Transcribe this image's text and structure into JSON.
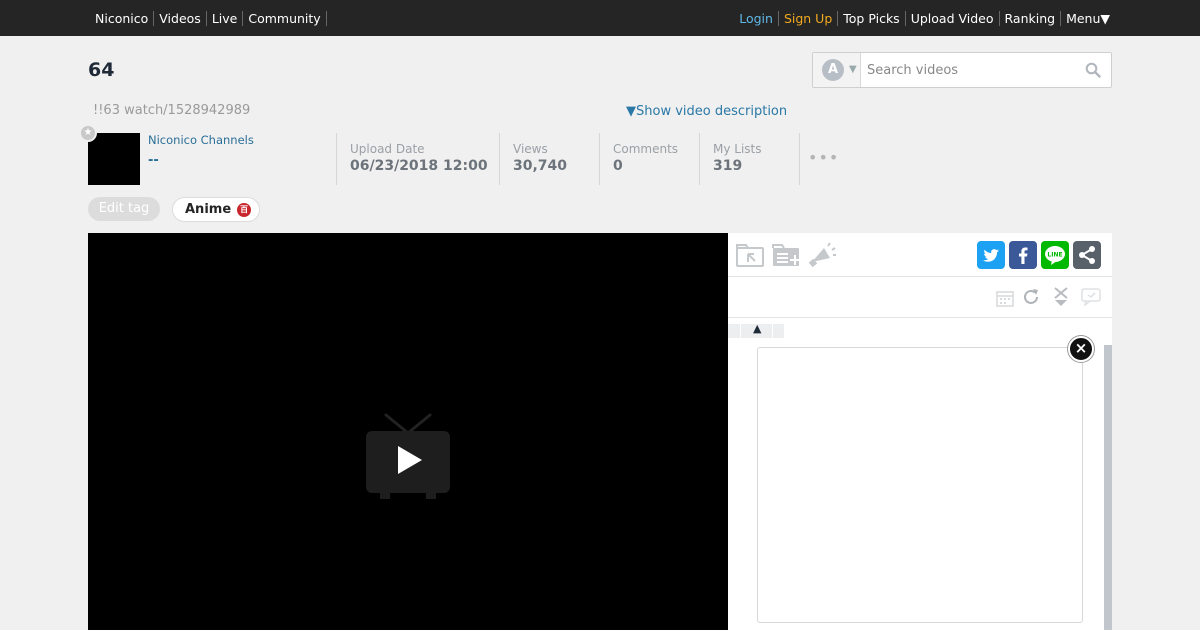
{
  "topbar": {
    "left_links": [
      "Niconico",
      "Videos",
      "Live",
      "Community"
    ],
    "login": "Login",
    "signup": "Sign Up",
    "right_links": [
      "Top Picks",
      "Upload Video",
      "Ranking",
      "Menu▼"
    ]
  },
  "video": {
    "title": "64",
    "subline": "!!63 watch/1528942989",
    "show_description": "▼Show video description"
  },
  "search": {
    "mode_letter": "A",
    "placeholder": "Search videos"
  },
  "owner": {
    "name": "Niconico Channels",
    "sub": "--"
  },
  "stats": {
    "upload_label": "Upload Date",
    "upload_value": "06/23/2018 12:00",
    "views_label": "Views",
    "views_value": "30,740",
    "comments_label": "Comments",
    "comments_value": "0",
    "mylists_label": "My Lists",
    "mylists_value": "319",
    "more": "•••"
  },
  "tags": {
    "edit_label": "Edit tag",
    "items": [
      {
        "label": "Anime",
        "dict_glyph": "百"
      }
    ]
  },
  "panel": {
    "sort_arrow": "▲",
    "close": "×"
  },
  "colors": {
    "topbar_bg": "#252525",
    "login": "#5fb7e6",
    "signup": "#f2a91f",
    "twitter": "#1da1f2",
    "facebook": "#3b5998",
    "line": "#00b900",
    "share": "#58606a"
  },
  "icons": [
    "search-icon",
    "favorite-star-icon",
    "play-tv-icon",
    "mylist-folder-icon",
    "playlist-add-icon",
    "uad-megaphone-icon",
    "calendar-icon",
    "reload-icon",
    "scroll-down-icon",
    "comment-icon",
    "twitter-icon",
    "facebook-icon",
    "line-icon",
    "share-icon",
    "close-icon"
  ]
}
